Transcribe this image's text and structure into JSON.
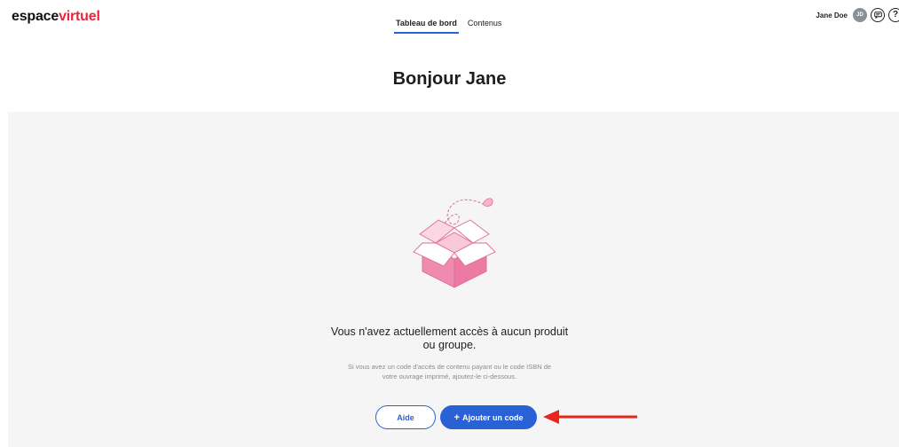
{
  "header": {
    "logo_main": "espace",
    "logo_accent": "virtuel",
    "tabs": [
      {
        "label": "Tableau de bord",
        "active": true
      },
      {
        "label": "Contenus",
        "active": false
      }
    ],
    "user_name": "Jane Doe",
    "avatar_initials": "JD",
    "help_label": "?",
    "icons": [
      "chat-icon",
      "help-icon"
    ]
  },
  "main": {
    "greeting": "Bonjour Jane",
    "empty_title_line1": "Vous n'avez actuellement accès à aucun produit",
    "empty_title_line2": "ou groupe.",
    "empty_desc_line1": "Si vous avez un code d'accès de contenu payant ou le code ISBN de",
    "empty_desc_line2": "votre ouvrage imprimé, ajoutez-le ci-dessous.",
    "help_button": "Aide",
    "add_code_plus": "+",
    "add_code_button": "Ajouter un code"
  },
  "colors": {
    "accent_blue": "#2862d6",
    "logo_red": "#e8253a",
    "box_pink": "#f08bb0",
    "arrow_red": "#e8271c",
    "panel_bg": "#f5f5f5"
  }
}
